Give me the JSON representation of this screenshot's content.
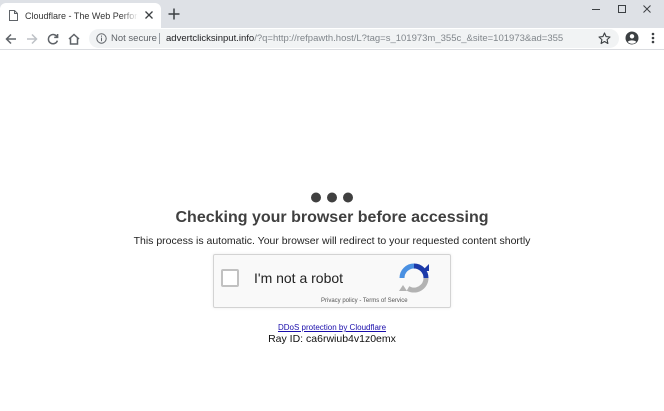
{
  "browser": {
    "tab": {
      "title": "Cloudflare - The Web Performance & Security Company"
    },
    "omnibox": {
      "security_label": "Not secure",
      "url_host": "advertclicksinput.info",
      "url_rest": "/?q=http://refpawth.host/L?tag=s_101973m_355c_&site=101973&ad=355"
    },
    "colors": {
      "tabstrip_bg": "#dee1e6",
      "omnibox_bg": "#f1f3f4",
      "link": "#1a0dab"
    }
  },
  "page": {
    "heading": "Checking your browser before accessing",
    "subtext": "This process is automatic. Your browser will redirect to your requested content shortly",
    "captcha": {
      "label": "I'm not a robot",
      "privacy_link": "Privacy policy",
      "separator": " - ",
      "terms_link": "Terms of Service"
    },
    "ddos_link": "DDoS protection by Cloudflare",
    "ray_id": "Ray ID: ca6rwiub4v1z0emx"
  }
}
